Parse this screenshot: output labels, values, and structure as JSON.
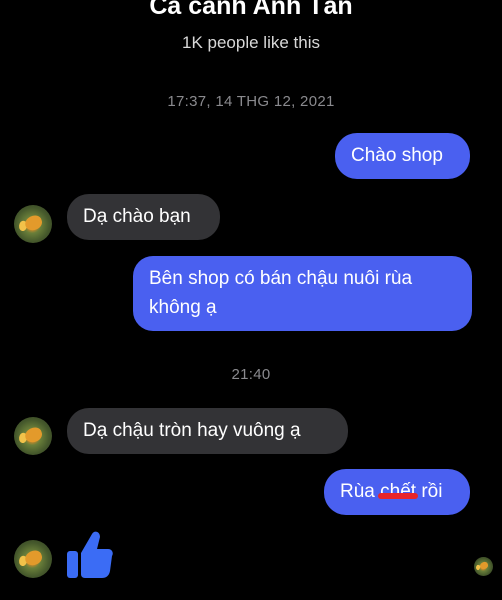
{
  "header": {
    "title": "Cá cảnh Anh Tấn",
    "subtitle": "1K people like this"
  },
  "conversation": {
    "timestamp_1": "17:37, 14 THG 12, 2021",
    "timestamp_2": "21:40",
    "messages": [
      {
        "sender": "me",
        "text": "Chào shop"
      },
      {
        "sender": "page",
        "text": "Dạ chào bạn"
      },
      {
        "sender": "me",
        "line1": "Bên shop có bán chậu nuôi rùa",
        "line2": "không ạ"
      },
      {
        "sender": "page",
        "text": "Dạ chậu tròn hay vuông ạ"
      },
      {
        "sender": "me",
        "text_before": "Rùa ",
        "text_struck": "chết",
        "text_after": " rồi"
      }
    ],
    "reaction": "thumbs-up-icon"
  },
  "colors": {
    "background": "#000000",
    "outgoing_bubble": "#4a60f0",
    "incoming_bubble": "#333336",
    "like_icon": "#3b6cf5",
    "strike_mark": "#e8242a"
  }
}
